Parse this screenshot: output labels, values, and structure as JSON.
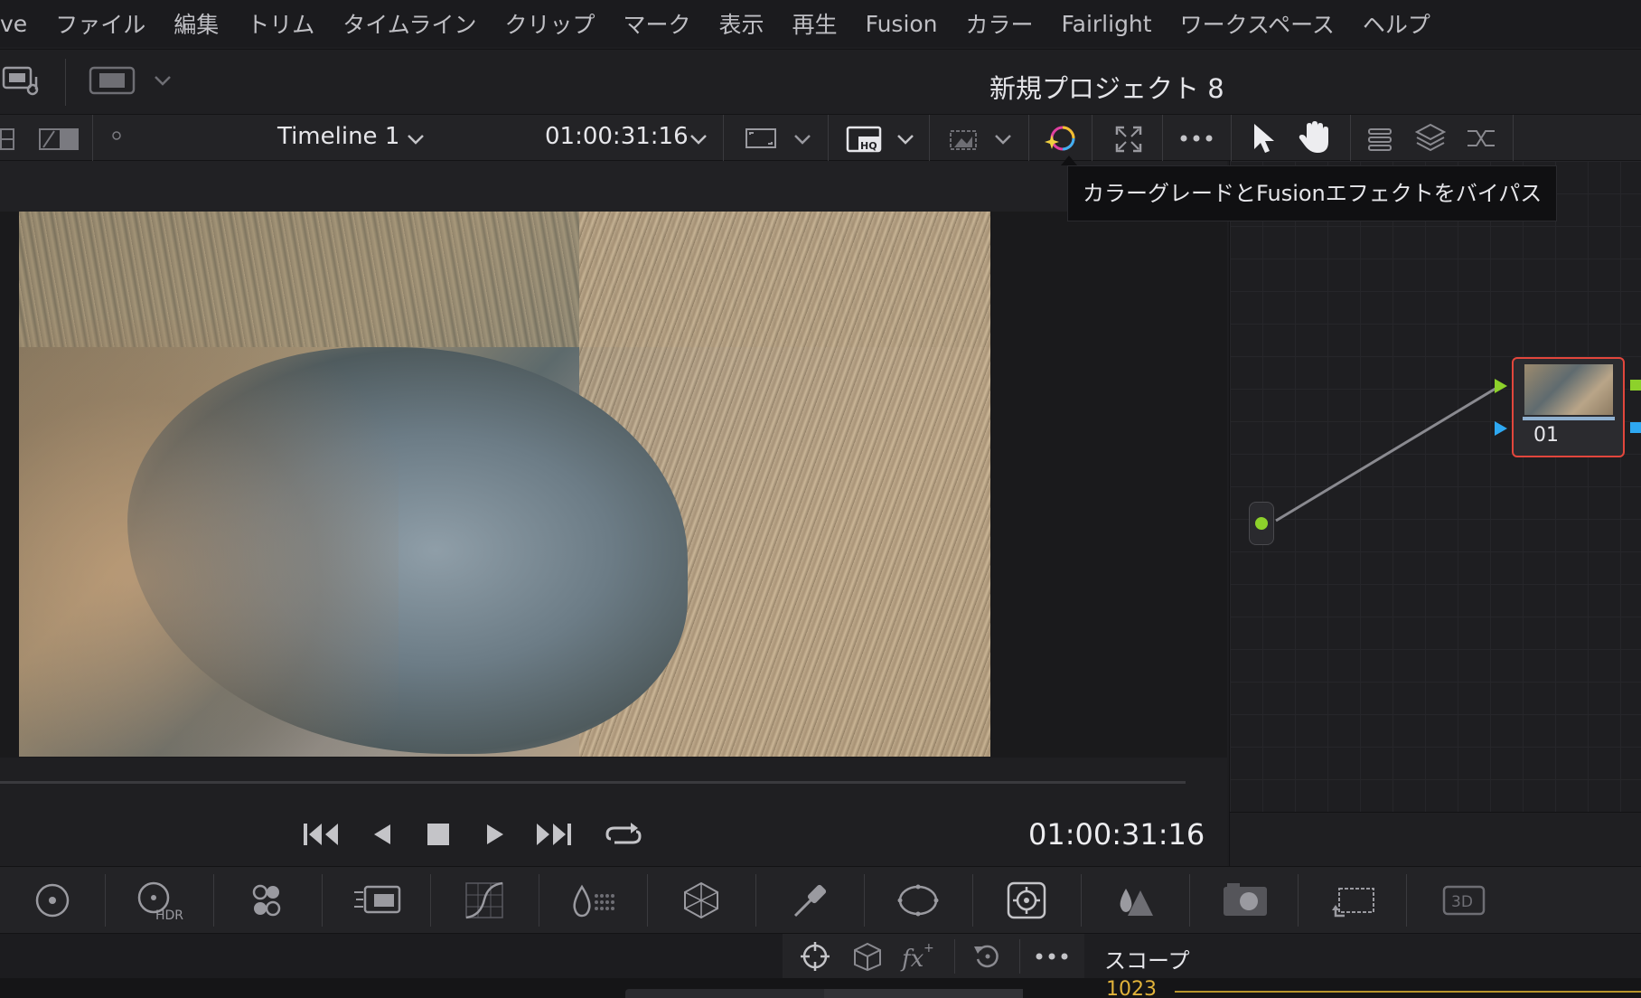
{
  "menu": {
    "items": [
      "ve",
      "ファイル",
      "編集",
      "トリム",
      "タイムライン",
      "クリップ",
      "マーク",
      "表示",
      "再生",
      "Fusion",
      "カラー",
      "Fairlight",
      "ワークスペース",
      "ヘルプ"
    ]
  },
  "project": {
    "title": "新規プロジェクト 8"
  },
  "viewer_toolbar": {
    "timeline_name": "Timeline 1",
    "timecode": "01:00:31:16"
  },
  "tooltip": {
    "text": "カラーグレードとFusionエフェクトをバイパス"
  },
  "node_editor": {
    "nodes": [
      {
        "label": "01"
      }
    ]
  },
  "transport": {
    "timecode": "01:00:31:16"
  },
  "bottom_bar": {
    "scope_label": "スコープ",
    "scope_value": "1023"
  },
  "colors": {
    "node_border": "#e2463c",
    "port_green": "#8dd12b",
    "port_blue": "#2ea8f2",
    "scope_yellow": "#e0b23a"
  }
}
